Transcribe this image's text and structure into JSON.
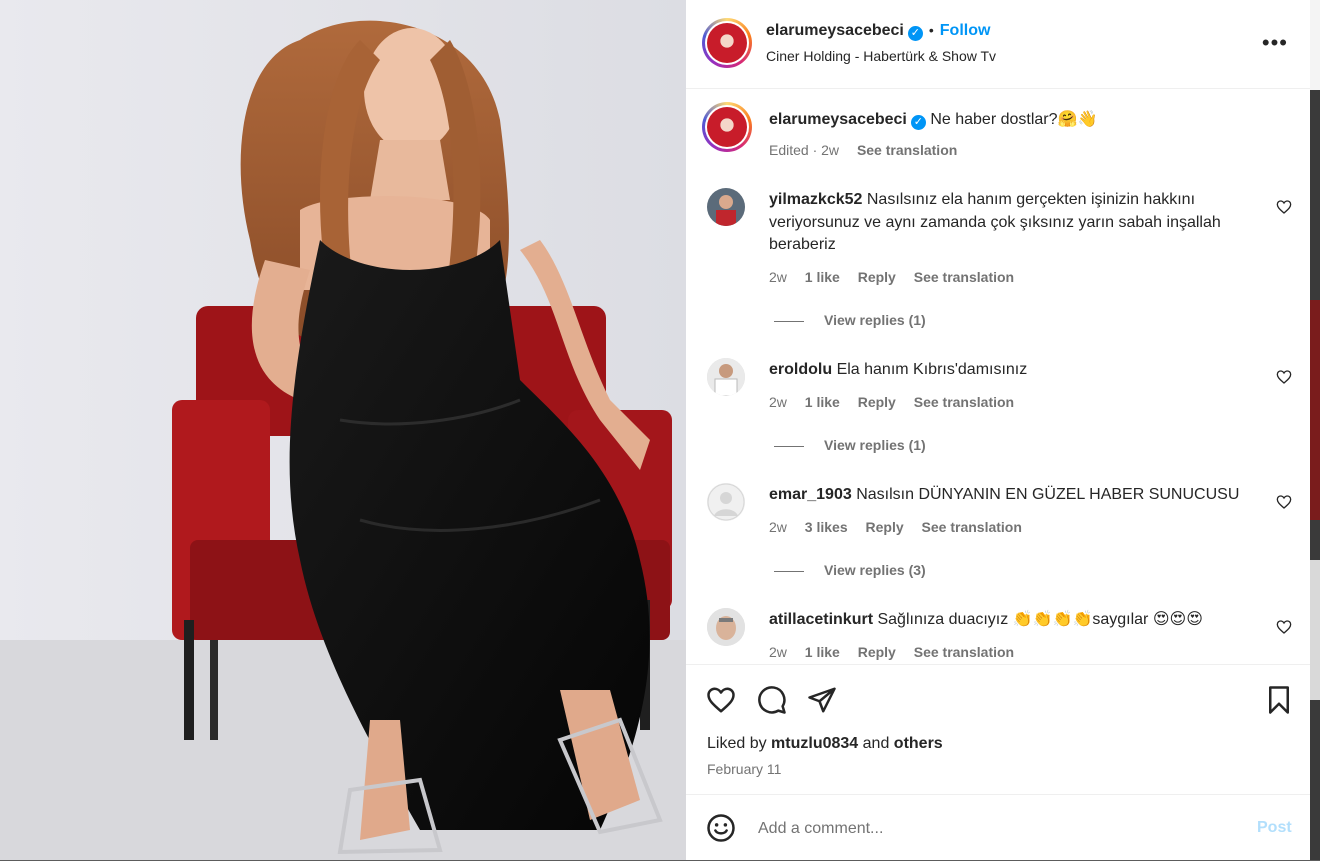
{
  "post": {
    "username": "elarumeysacebeci",
    "follow_label": "Follow",
    "subtitle": "Ciner Holding - Habertürk & Show Tv",
    "more_label": "•••"
  },
  "caption": {
    "username": "elarumeysacebeci",
    "text": "Ne haber dostlar?🤗👋",
    "edited": "Edited · 2w",
    "see_translation": "See translation"
  },
  "comments": [
    {
      "username": "yilmazkck52",
      "text": "Nasılsınız ela hanım gerçekten işinizin hakkını veriyorsunuz ve aynı zamanda çok şıksınız yarın sabah inşallah beraberiz",
      "age": "2w",
      "likes": "1 like",
      "reply": "Reply",
      "see_translation": "See translation",
      "view_replies": "View replies (1)"
    },
    {
      "username": "eroldolu",
      "text": "Ela hanım Kıbrıs'damısınız",
      "age": "2w",
      "likes": "1 like",
      "reply": "Reply",
      "see_translation": "See translation",
      "view_replies": "View replies (1)"
    },
    {
      "username": "emar_1903",
      "text": "Nasılsın DÜNYANIN EN GÜZEL HABER SUNUCUSU",
      "age": "2w",
      "likes": "3 likes",
      "reply": "Reply",
      "see_translation": "See translation",
      "view_replies": "View replies (3)"
    },
    {
      "username": "atillacetinkurt",
      "text": "Sağlınıza duacıyız 👏👏👏👏saygılar 😍😍😍",
      "age": "2w",
      "likes": "1 like",
      "reply": "Reply",
      "see_translation": "See translation"
    }
  ],
  "liked_by": {
    "prefix": "Liked by",
    "user": "mtuzlu0834",
    "and": "and",
    "others": "others"
  },
  "date": "February 11",
  "add_comment": {
    "placeholder": "Add a comment...",
    "post_label": "Post"
  },
  "colors": {
    "accent": "#0095f6",
    "post_disabled": "#b2dffc",
    "muted": "#737373"
  }
}
